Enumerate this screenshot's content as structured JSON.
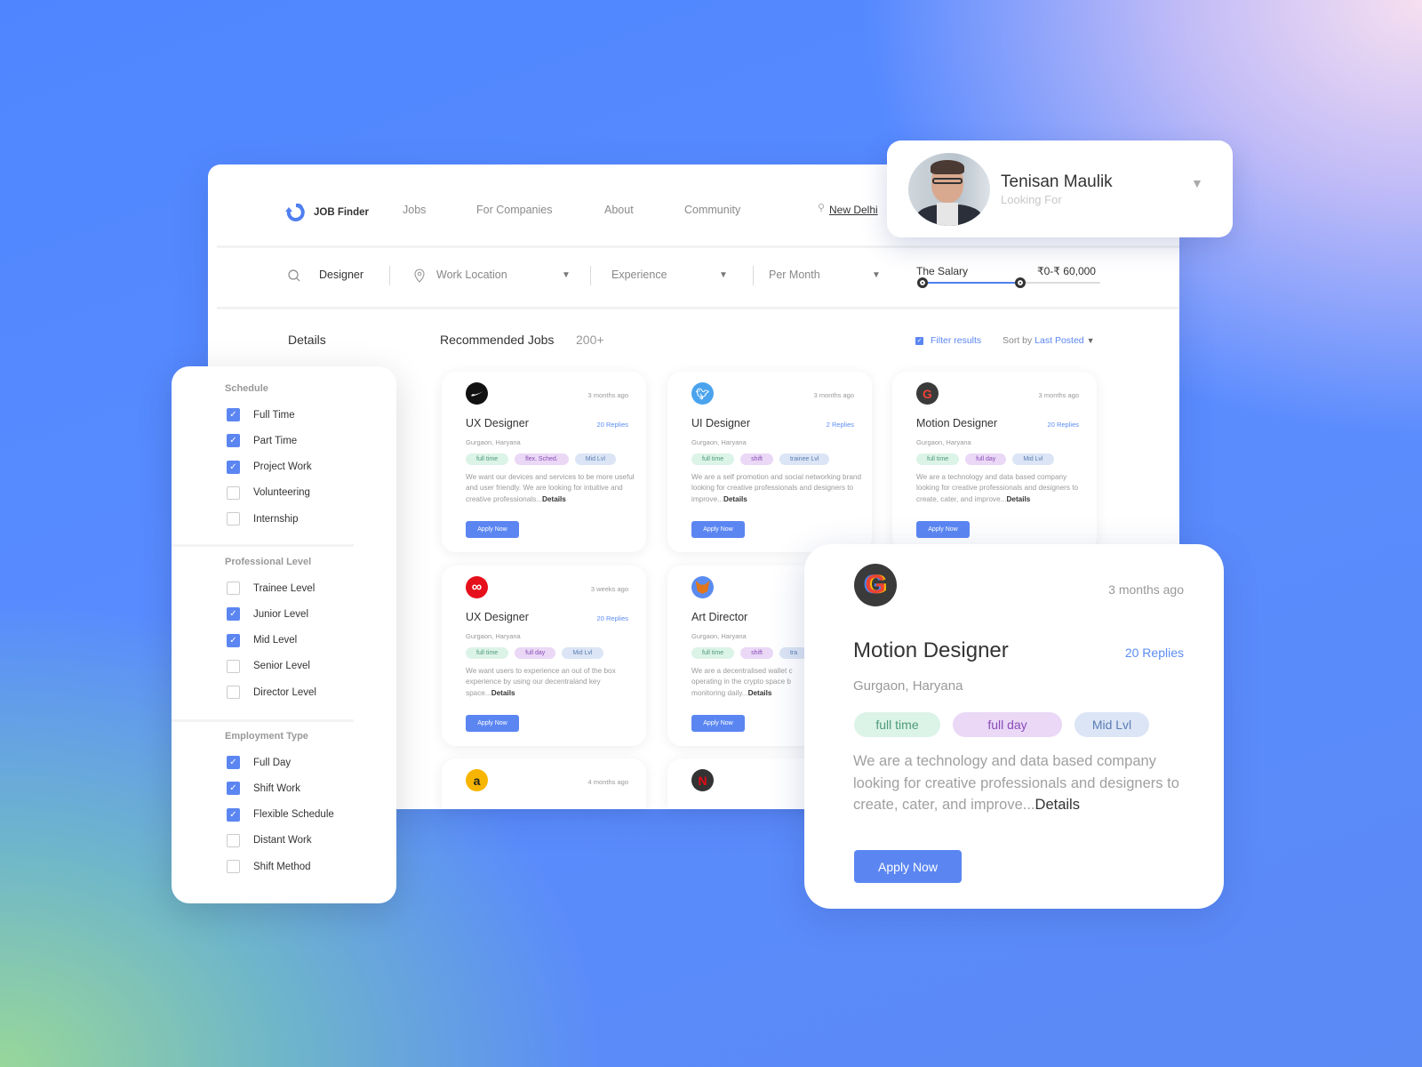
{
  "header": {
    "brand": "JOB Finder",
    "nav": [
      "Jobs",
      "For Companies",
      "About",
      "Community"
    ],
    "location": "New Delhi"
  },
  "profile": {
    "name": "Tenisan Maulik",
    "subtitle": "Looking For"
  },
  "search": {
    "query": "Designer",
    "work_location": "Work Location",
    "experience": "Experience",
    "period": "Per Month",
    "salary_label": "The Salary",
    "salary_range": "₹0-₹ 60,000",
    "salary_fill": 0.55
  },
  "section": {
    "details": "Details",
    "recommended": "Recommended Jobs",
    "count": "200+",
    "filter_results": "Filter results",
    "sort_by": "Sort by",
    "sort_value": "Last Posted"
  },
  "filters": [
    {
      "title": "Schedule",
      "items": [
        {
          "label": "Full Time",
          "checked": true
        },
        {
          "label": "Part Time",
          "checked": true
        },
        {
          "label": "Project Work",
          "checked": true
        },
        {
          "label": "Volunteering",
          "checked": false
        },
        {
          "label": "Internship",
          "checked": false
        }
      ]
    },
    {
      "title": "Professional Level",
      "items": [
        {
          "label": "Trainee Level",
          "checked": false
        },
        {
          "label": "Junior Level",
          "checked": true
        },
        {
          "label": "Mid Level",
          "checked": true
        },
        {
          "label": "Senior Level",
          "checked": false
        },
        {
          "label": "Director Level",
          "checked": false
        }
      ]
    },
    {
      "title": "Employment Type",
      "items": [
        {
          "label": "Full Day",
          "checked": true
        },
        {
          "label": "Shift Work",
          "checked": true
        },
        {
          "label": "Flexible Schedule",
          "checked": true
        },
        {
          "label": "Distant Work",
          "checked": false
        },
        {
          "label": "Shift Method",
          "checked": false
        }
      ]
    }
  ],
  "jobs": [
    {
      "company_icon": "nike-logo",
      "time": "3 months ago",
      "title": "UX Designer",
      "replies": "20 Replies",
      "location": "Gurgaon, Haryana",
      "tags": [
        "full time",
        "flex. Sched.",
        "Mid Lvl"
      ],
      "desc": "We want our devices and services to be more useful and user friendly. We are looking for intuitive and creative professionals...",
      "details": "Details",
      "apply": "Apply Now"
    },
    {
      "company_icon": "twitter-logo",
      "time": "3 months ago",
      "title": "UI Designer",
      "replies": "2 Replies",
      "location": "Gurgaon, Haryana",
      "tags": [
        "full time",
        "shift",
        "trainee Lvl"
      ],
      "desc": "We are a self promotion and social networking brand looking for creative professionals and designers to improve...",
      "details": "Details",
      "apply": "Apply Now"
    },
    {
      "company_icon": "google-logo",
      "time": "3 months ago",
      "title": "Motion Designer",
      "replies": "20 Replies",
      "location": "Gurgaon, Haryana",
      "tags": [
        "full time",
        "full day",
        "Mid Lvl"
      ],
      "desc": "We are a technology and data based company looking for creative professionals and designers to create, cater, and improve...",
      "details": "Details",
      "apply": "Apply Now"
    },
    {
      "company_icon": "meta-logo",
      "time": "3 weeks ago",
      "title": "UX Designer",
      "replies": "20 Replies",
      "location": "Gurgaon, Haryana",
      "tags": [
        "full time",
        "full day",
        "Mid Lvl"
      ],
      "desc": "We want users to experience an out of the box experience by using our decentraland key space...",
      "details": "Details",
      "apply": "Apply Now"
    },
    {
      "company_icon": "metamask-logo",
      "title": "Art Director",
      "location": "Gurgaon, Haryana",
      "tags": [
        "full time",
        "shift",
        "tra"
      ],
      "desc_lines": [
        "We are a decentralised wallet c",
        "operating in the crypto space b",
        "monitoring daily..."
      ],
      "details": "Details",
      "apply": "Apply Now"
    },
    {
      "company_icon": "amazon-logo",
      "time": "4 months ago"
    },
    {
      "company_icon": "netflix-logo"
    }
  ],
  "featured": {
    "company_icon": "google-logo",
    "time": "3 months ago",
    "title": "Motion Designer",
    "replies": "20 Replies",
    "location": "Gurgaon, Haryana",
    "tags": [
      "full time",
      "full day",
      "Mid Lvl"
    ],
    "desc": "We are a technology and data based company looking for creative professionals and designers to create, cater, and improve...",
    "details": "Details",
    "apply": "Apply Now"
  },
  "colors": {
    "accent": "#5b86f2",
    "tag_green": "#dcf3e8",
    "tag_purple": "#ead8f6",
    "tag_blue": "#dbe5f5"
  }
}
